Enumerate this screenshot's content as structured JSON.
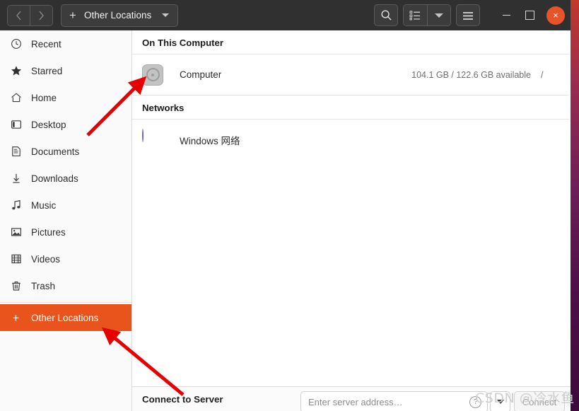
{
  "window": {
    "title": "Other Locations"
  },
  "header": {
    "back_icon": "chevron-left-icon",
    "forward_icon": "chevron-right-icon",
    "path_plus": "+",
    "path_label": "Other Locations",
    "search_icon": "search-icon",
    "view_list_icon": "list-view-icon",
    "view_dropdown_icon": "chevron-down-icon",
    "menu_icon": "hamburger-menu-icon",
    "minimize_label": "",
    "maximize_label": "",
    "close_label": "×"
  },
  "sidebar": {
    "items": [
      {
        "label": "Recent",
        "icon": "clock-icon",
        "active": false
      },
      {
        "label": "Starred",
        "icon": "star-icon",
        "active": false
      },
      {
        "label": "Home",
        "icon": "home-icon",
        "active": false
      },
      {
        "label": "Desktop",
        "icon": "desktop-icon",
        "active": false
      },
      {
        "label": "Documents",
        "icon": "document-icon",
        "active": false
      },
      {
        "label": "Downloads",
        "icon": "download-icon",
        "active": false
      },
      {
        "label": "Music",
        "icon": "music-note-icon",
        "active": false
      },
      {
        "label": "Pictures",
        "icon": "picture-icon",
        "active": false
      },
      {
        "label": "Videos",
        "icon": "film-icon",
        "active": false
      },
      {
        "label": "Trash",
        "icon": "trash-icon",
        "active": false
      }
    ],
    "other_locations": {
      "label": "Other Locations",
      "icon": "plus-icon",
      "active": true
    },
    "accent_color": "#e9541d"
  },
  "main": {
    "sections": [
      {
        "heading": "On This Computer",
        "rows": [
          {
            "name": "Computer",
            "icon": "disc-drive-icon",
            "meta": "104.1 GB / 122.6 GB available",
            "mount": "/"
          }
        ]
      },
      {
        "heading": "Networks",
        "rows": [
          {
            "name": "Windows 网络",
            "icon": "network-globe-icon",
            "meta": "",
            "mount": ""
          }
        ]
      }
    ]
  },
  "connect_bar": {
    "label": "Connect to Server",
    "address_value": "",
    "address_placeholder": "Enter server address…",
    "help_icon": "question-mark-icon",
    "dropdown_icon": "chevron-down-icon",
    "connect_label": "Connect"
  },
  "watermark": {
    "text": "CSDN @冷水鱼"
  }
}
